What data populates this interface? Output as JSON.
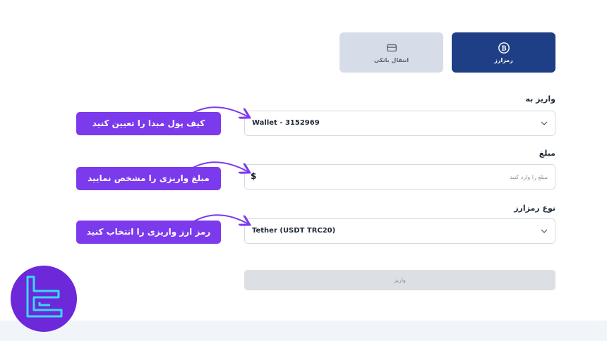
{
  "methods": {
    "crypto": {
      "label": "رمزارز",
      "icon": "bitcoin-icon",
      "active": true
    },
    "bank": {
      "label": "انتقال بانکی",
      "icon": "card-icon",
      "active": false
    }
  },
  "form": {
    "deposit_to": {
      "label": "واریز به",
      "value": "Wallet - 3152969"
    },
    "amount": {
      "label": "مبلغ",
      "currency": "$",
      "placeholder": "مبلغ را وارد کنید"
    },
    "currency_type": {
      "label": "نوع رمزارز",
      "value": "Tether (USDT TRC20)"
    },
    "submit_label": "واریز"
  },
  "annotations": {
    "wallet": "کیف پول مبدا را تعیین کنید",
    "amount": "مبلغ واریزی را مشخص نمایید",
    "crypto": "رمز ارز واریزی را انتخاب کنید"
  },
  "colors": {
    "accent": "#1e3f86",
    "callout": "#7c3aed",
    "logo_bg": "#6d28d9",
    "logo_stroke": "#38d9f5"
  }
}
